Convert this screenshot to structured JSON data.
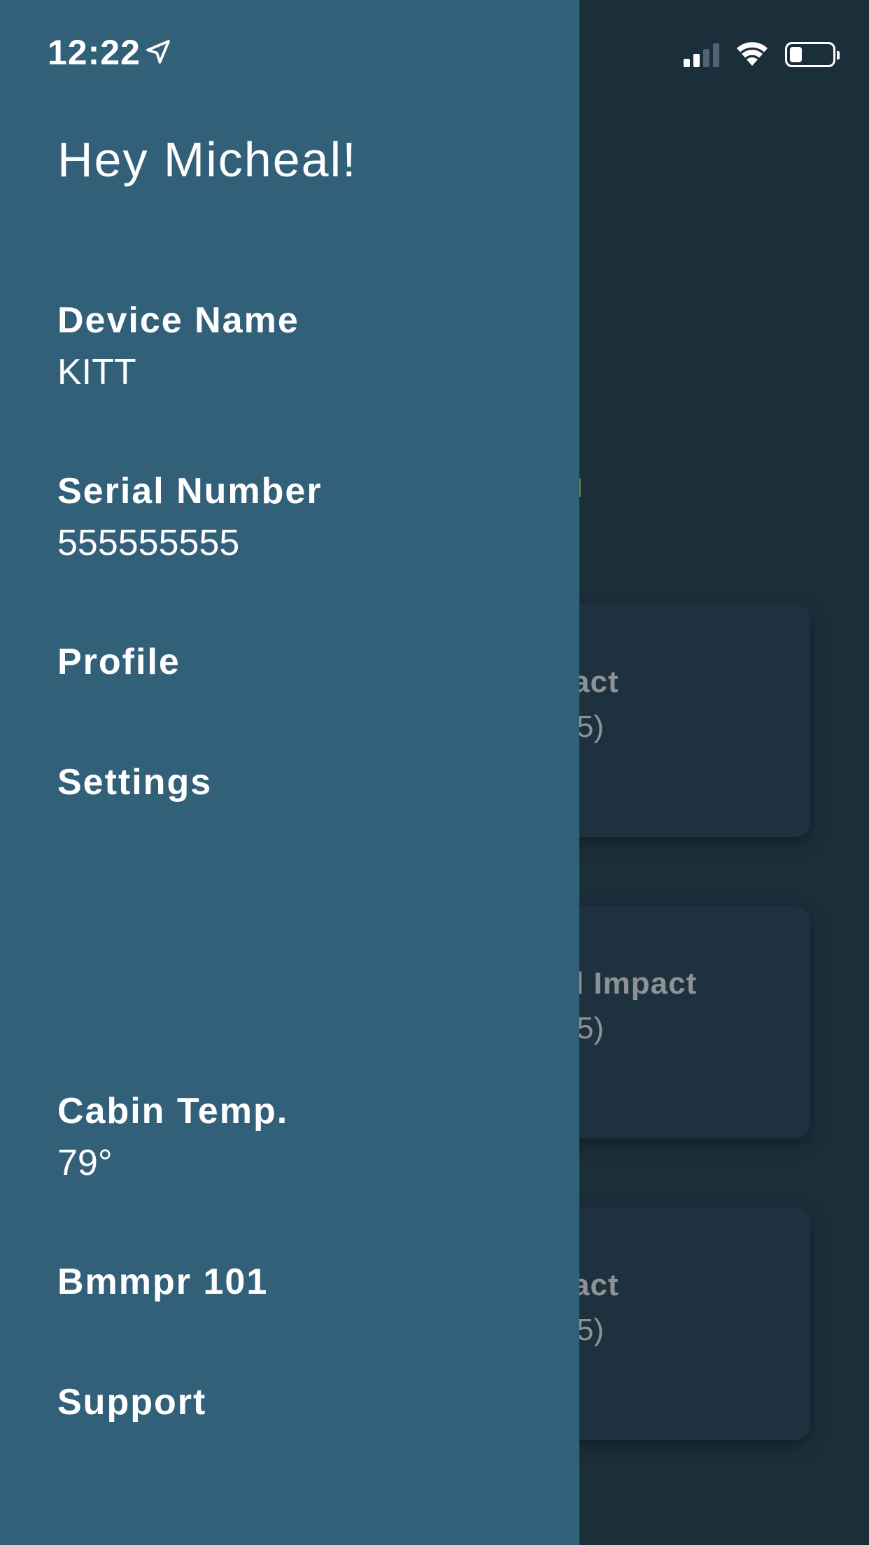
{
  "status_bar": {
    "time": "12:22",
    "location_icon": "location-arrow-icon",
    "signal_icon": "cellular-signal-icon",
    "signal_bars_active": 2,
    "wifi_icon": "wifi-icon",
    "battery_icon": "battery-icon",
    "battery_level": 0.3
  },
  "drawer": {
    "greeting": "Hey Micheal!",
    "device_name": {
      "label": "Device Name",
      "value": "KITT"
    },
    "serial_number": {
      "label": "Serial Number",
      "value": "555555555"
    },
    "profile_label": "Profile",
    "settings_label": "Settings",
    "cabin_temp": {
      "label": "Cabin Temp.",
      "value": "79°"
    },
    "bmmpr_label": "Bmmpr 101",
    "support_label": "Support",
    "background_color": "#336079"
  },
  "background": {
    "cards": [
      {
        "title_fragment": "act",
        "subtitle_fragment": "5)"
      },
      {
        "title_fragment": "l Impact",
        "subtitle_fragment": "5)"
      },
      {
        "title_fragment": "act",
        "subtitle_fragment": "5)"
      }
    ]
  }
}
